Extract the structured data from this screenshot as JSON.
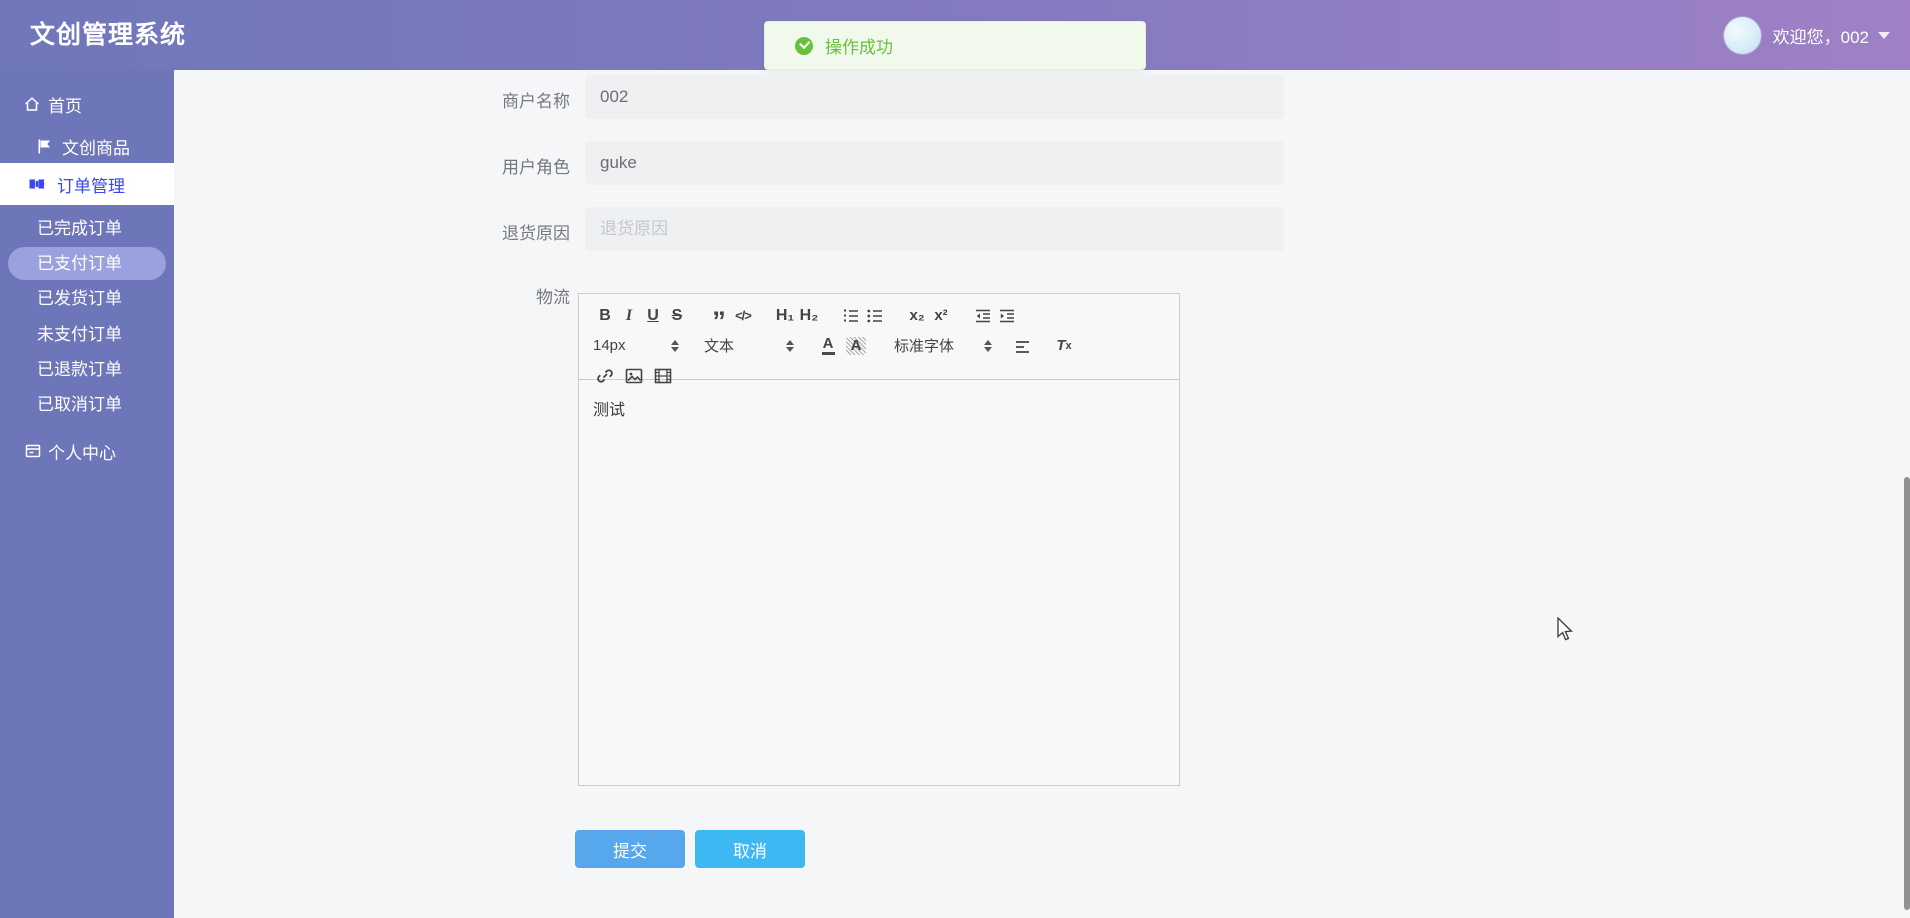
{
  "app": {
    "title": "文创管理系统"
  },
  "header": {
    "welcome": "欢迎您，002"
  },
  "toast": {
    "text": "操作成功",
    "status": "success"
  },
  "sidebar": {
    "items": [
      {
        "label": "首页",
        "icon": "home-icon",
        "level": 1
      },
      {
        "label": "文创商品",
        "icon": "flag-icon",
        "level": 1
      },
      {
        "label": "订单管理",
        "icon": "ticket-icon",
        "level": 1,
        "active": true
      },
      {
        "label": "已完成订单",
        "level": 2
      },
      {
        "label": "已支付订单",
        "level": 2,
        "active": true
      },
      {
        "label": "已发货订单",
        "level": 2
      },
      {
        "label": "未支付订单",
        "level": 2
      },
      {
        "label": "已退款订单",
        "level": 2
      },
      {
        "label": "已取消订单",
        "level": 2
      },
      {
        "label": "个人中心",
        "icon": "card-icon",
        "level": 1
      }
    ]
  },
  "form": {
    "fields": [
      {
        "label": "商户名称",
        "value": "002"
      },
      {
        "label": "用户角色",
        "value": "guke"
      },
      {
        "label": "退货原因",
        "value": "",
        "placeholder": "退货原因"
      },
      {
        "label": "物流"
      }
    ],
    "editor": {
      "content": "测试",
      "size_label": "14px",
      "paragraph_label": "文本",
      "font_label": "标准字体",
      "glyphs": {
        "bold": "B",
        "italic": "I",
        "underline": "U",
        "strike": "S",
        "blockquote": "”",
        "code": "</>",
        "h1": "H₁",
        "h2": "H₂",
        "subscript": "x₂",
        "superscript": "x²",
        "color": "A",
        "highlight": "A",
        "clean": "T"
      },
      "toolbar_icons": [
        "bold",
        "italic",
        "underline",
        "strike",
        "blockquote",
        "code-block",
        "header-1",
        "header-2",
        "list-ordered",
        "list-bullet",
        "subscript",
        "superscript",
        "outdent",
        "indent",
        "font-size-select",
        "paragraph-select",
        "text-color",
        "highlight-color",
        "font-family-select",
        "align",
        "clean-format",
        "link",
        "image",
        "video"
      ]
    },
    "buttons": {
      "submit": "提交",
      "cancel": "取消"
    }
  },
  "colors": {
    "header_gradient_left": "#7077bb",
    "header_gradient_right": "#9f80c6",
    "sidebar_bg": "#6d76b9",
    "sidebar_active_pill": "#99a1de",
    "active_menu_text": "#3b46ee",
    "toast_bg": "#f0f9eb",
    "toast_green": "#67c23a",
    "input_bg": "#eff0f2",
    "submit_btn": "#57a7ec",
    "cancel_btn": "#3eb8f3"
  }
}
